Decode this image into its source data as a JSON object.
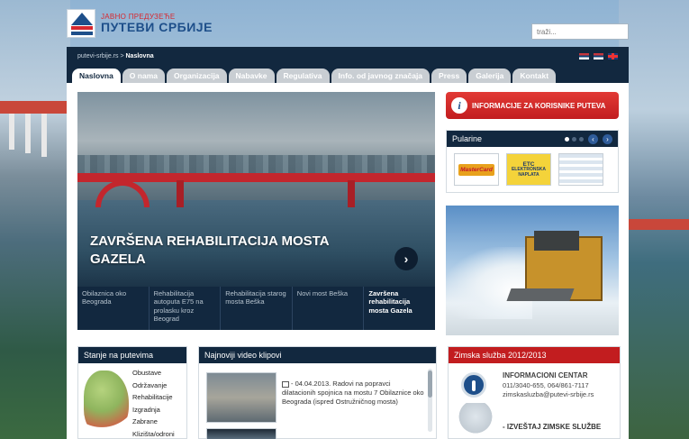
{
  "header": {
    "logo_sub": "ЈАВНО ПРЕДУЗЕЋЕ",
    "logo_main": "ПУТЕВИ СРБИЈЕ",
    "search_placeholder": "traži..."
  },
  "topbar": {
    "breadcrumb_root": "putevi-srbije.rs",
    "breadcrumb_sep": " > ",
    "breadcrumb_current": "Naslovna",
    "flags": [
      "rs-cyrillic-flag",
      "rs-latin-flag",
      "uk-flag"
    ]
  },
  "nav": {
    "tabs": [
      {
        "label": "Naslovna",
        "active": true
      },
      {
        "label": "O nama"
      },
      {
        "label": "Organizacija"
      },
      {
        "label": "Nabavke"
      },
      {
        "label": "Regulativa"
      },
      {
        "label": "Info. od javnog značaja"
      },
      {
        "label": "Press"
      },
      {
        "label": "Galerija"
      },
      {
        "label": "Kontakt"
      }
    ]
  },
  "hero": {
    "title": "ZAVRŠENA REHABILITACIJA MOSTA GAZELA",
    "next_label": "›",
    "slides": [
      {
        "label": "Obilaznica oko Beograda"
      },
      {
        "label": "Rehabilitacija autoputa E75 na prolasku kroz Beograd"
      },
      {
        "label": "Rehabilitacija starog mosta Beška"
      },
      {
        "label": "Novi most Beška"
      },
      {
        "label": "Završena rehabilitacija mosta Gazela",
        "active": true
      }
    ]
  },
  "info_button": {
    "icon_letter": "i",
    "label": "INFORMACIJE ZA KORISNIKE PUTEVA"
  },
  "pay": {
    "title": "Pularine",
    "prev": "‹",
    "next": "›",
    "mastercard": "MasterCard",
    "etc_line1": "ETC",
    "etc_line2": "ELEKTRONSKA NAPLATA"
  },
  "stanje": {
    "title": "Stanje na putevima",
    "items": [
      "Obustave",
      "Održavanje",
      "Rehabilitacije",
      "Izgradnja",
      "Zabrane",
      "Klizišta/odroni"
    ]
  },
  "video": {
    "title": "Najnoviji video klipovi",
    "item_text": "- 04.04.2013. Radovi na popravci dilatacionih spojnica na mostu 7 Obilaznice oko Beograda (ispred Ostružničnog mosta)"
  },
  "zimska": {
    "title": "Zimska služba 2012/2013",
    "center_title": "INFORMACIONI CENTAR",
    "phones": "011/3040-655, 064/861-7117",
    "email": "zimskasluzba@putevi-srbije.rs",
    "report": "- IZVEŠTAJ ZIMSKE SLUŽBE"
  },
  "colors": {
    "navy": "#12283f",
    "brand_red": "#c21d1f",
    "brand_blue": "#1e4f8a"
  }
}
